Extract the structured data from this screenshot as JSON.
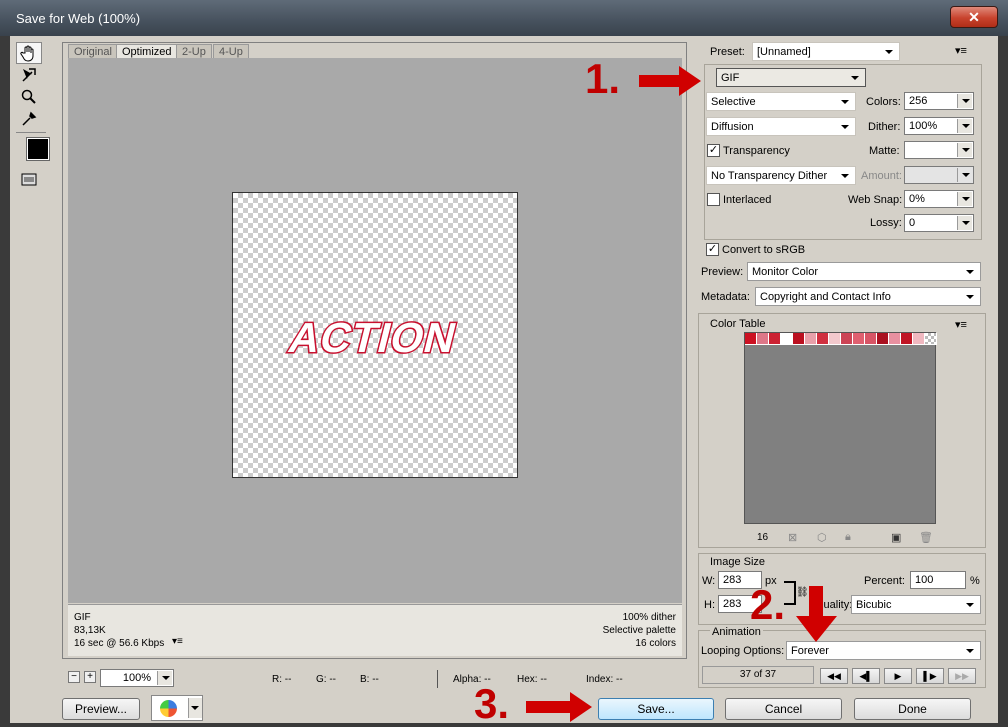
{
  "window": {
    "title": "Save for Web (100%)"
  },
  "tabs": [
    "Original",
    "Optimized",
    "2-Up",
    "4-Up"
  ],
  "preview": {
    "artwork_text": "ACTION",
    "info_left": {
      "format": "GIF",
      "size": "83,13K",
      "time": "16 sec @ 56.6 Kbps"
    },
    "info_right": {
      "dither": "100% dither",
      "palette": "Selective palette",
      "colors": "16 colors"
    }
  },
  "status": {
    "zoom": "100%",
    "readouts": {
      "r": "R: --",
      "g": "G: --",
      "b": "B: --",
      "alpha": "Alpha: --",
      "hex": "Hex: --",
      "index": "Index: --"
    }
  },
  "settings": {
    "preset_label": "Preset:",
    "preset": "[Unnamed]",
    "format": "GIF",
    "reduction": "Selective",
    "dither_algo": "Diffusion",
    "colors_label": "Colors:",
    "colors": "256",
    "dither_label": "Dither:",
    "dither": "100%",
    "transparency_label": "Transparency",
    "transparency_checked": true,
    "matte_label": "Matte:",
    "transparency_dither": "No Transparency Dither",
    "amount_label": "Amount:",
    "interlaced_label": "Interlaced",
    "interlaced_checked": false,
    "websnap_label": "Web Snap:",
    "websnap": "0%",
    "lossy_label": "Lossy:",
    "lossy": "0",
    "srgb_label": "Convert to sRGB",
    "srgb_checked": true,
    "preview_label": "Preview:",
    "preview_value": "Monitor Color",
    "metadata_label": "Metadata:",
    "metadata_value": "Copyright and Contact Info"
  },
  "color_table": {
    "title": "Color Table",
    "count": "16",
    "swatches": [
      "#cc1122",
      "#dd7788",
      "#cc2233",
      "#ffffff",
      "#bb1020",
      "#e8a0aa",
      "#d03040",
      "#f2c8cc",
      "#cc4455",
      "#e06070",
      "#d85566",
      "#aa1020",
      "#e890a0",
      "#c01525",
      "#f0b8c0",
      "checker"
    ]
  },
  "image_size": {
    "title": "Image Size",
    "w_label": "W:",
    "w": "283",
    "h_label": "H:",
    "h": "283",
    "unit": "px",
    "percent_label": "Percent:",
    "percent": "100",
    "percent_unit": "%",
    "quality_label": "Quality:",
    "quality": "Bicubic"
  },
  "animation": {
    "title": "Animation",
    "looping_label": "Looping Options:",
    "looping": "Forever",
    "frame": "37 of 37"
  },
  "buttons": {
    "preview": "Preview...",
    "save": "Save...",
    "cancel": "Cancel",
    "done": "Done"
  },
  "annotations": [
    "1.",
    "2.",
    "3."
  ],
  "colors": {
    "annotation_red": "#d00000",
    "canvas_gray": "#a9a9a9",
    "dialog_bg": "#d4d0c8",
    "art_red": "#c8102e"
  }
}
